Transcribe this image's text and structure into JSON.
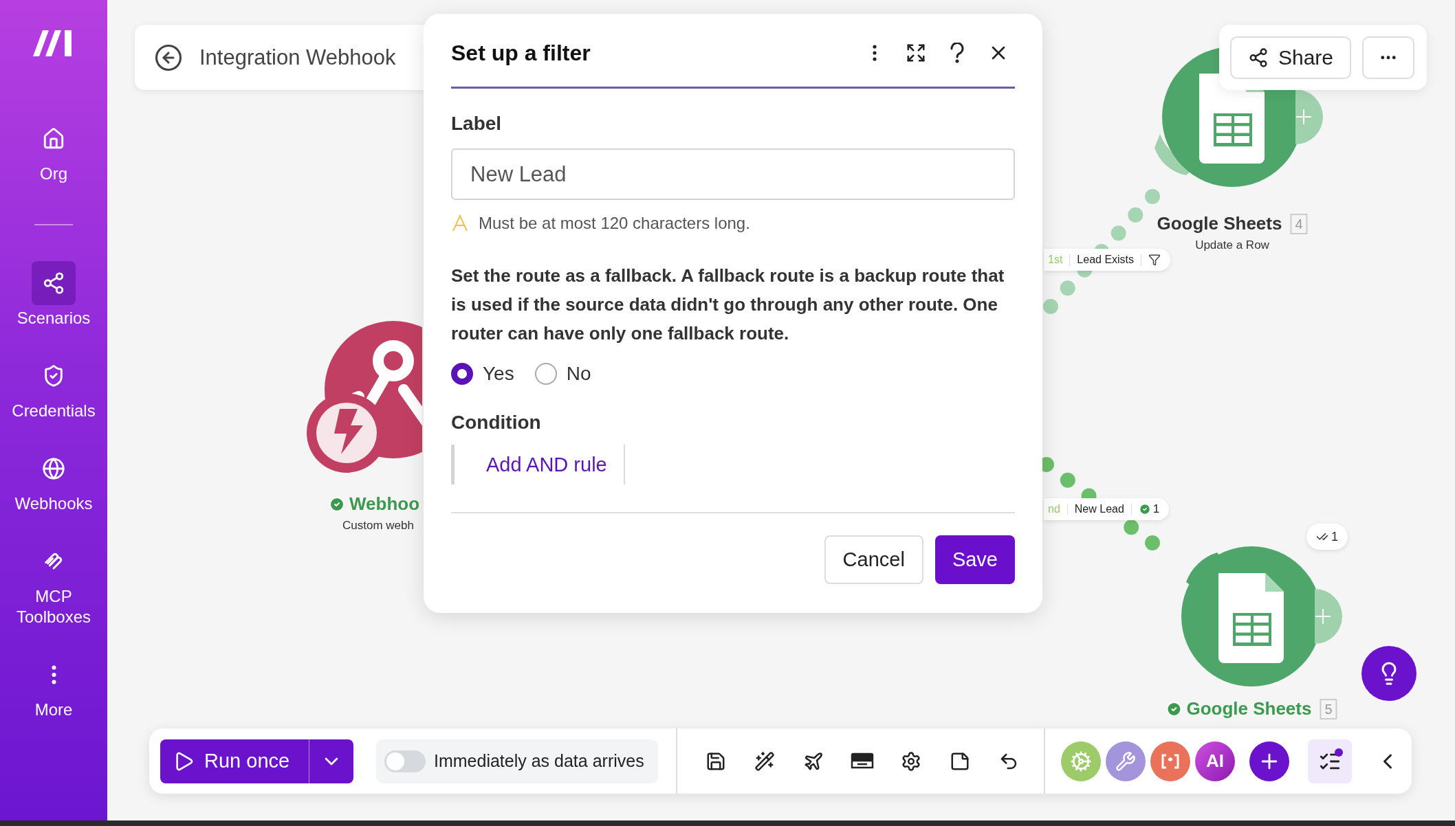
{
  "sidebar": {
    "items": [
      {
        "label": "Org",
        "selected": false
      },
      {
        "label": "Scenarios",
        "selected": true
      },
      {
        "label": "Credentials",
        "selected": false
      },
      {
        "label": "Webhooks",
        "selected": false
      },
      {
        "label": "MCP Toolboxes",
        "selected": false
      },
      {
        "label": "More",
        "selected": false
      }
    ]
  },
  "header": {
    "title": "Integration Webhook"
  },
  "share": {
    "label": "Share"
  },
  "nodes": [
    {
      "kind": "webhook",
      "title": "Webhoo",
      "subtitle": "Custom webh",
      "succeeded": true
    },
    {
      "kind": "sheets",
      "title": "Google Sheets",
      "number": "4",
      "subtitle": "Update a Row",
      "succeeded": false
    },
    {
      "kind": "sheets",
      "title": "Google Sheets",
      "number": "5",
      "succeeded": true
    }
  ],
  "routes": [
    {
      "order": "1st",
      "label": "Lead Exists",
      "kind": "filter"
    },
    {
      "order": "nd",
      "label": "New Lead",
      "kind": "count",
      "count": "1"
    }
  ],
  "operations_badge": "1",
  "dialog": {
    "title": "Set up a filter",
    "label_heading": "Label",
    "label_value": "New Lead",
    "warning": "Must be at most 120 characters long.",
    "fallback_text": "Set the route as a fallback. A fallback route is a backup route that is used if the source data didn't go through any other route. One router can have only one fallback route.",
    "fallback_options": [
      {
        "label": "Yes",
        "selected": true
      },
      {
        "label": "No",
        "selected": false
      }
    ],
    "condition_heading": "Condition",
    "add_rule": "Add AND rule",
    "buttons": [
      {
        "label": "Cancel",
        "kind": "secondary"
      },
      {
        "label": "Save",
        "kind": "primary"
      }
    ]
  },
  "toolbar": {
    "run_label": "Run once",
    "schedule": {
      "label": "Immediately as data arrives",
      "on": false
    },
    "ai_label": "AI",
    "checklist_notification": true
  }
}
